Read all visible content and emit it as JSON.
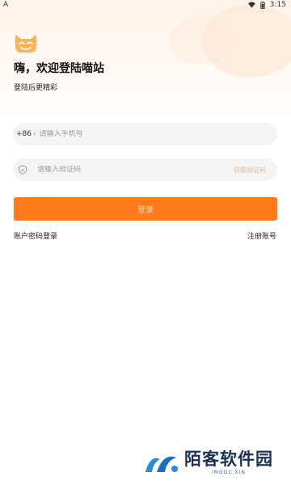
{
  "status_bar": {
    "left_indicator": "A",
    "time": "3:15"
  },
  "header": {
    "title": "嗨，欢迎登陆喵站",
    "subtitle": "登陆后更精彩"
  },
  "phone_field": {
    "country_code": "+86",
    "placeholder": "请输入手机号"
  },
  "code_field": {
    "placeholder": "请输入验证码",
    "get_code_label": "获取验证码"
  },
  "login_button": {
    "label": "登录"
  },
  "links": {
    "password_login": "账户密码登录",
    "register": "注册账号"
  },
  "watermark": {
    "title": "陌客软件园",
    "domain": "IMOOC.XIN"
  },
  "colors": {
    "accent": "#fe7a1a",
    "logo": "#f7b65a"
  },
  "icons": [
    "cat-logo-icon",
    "wifi-icon",
    "battery-icon",
    "shield-icon",
    "chevron-right-icon"
  ]
}
